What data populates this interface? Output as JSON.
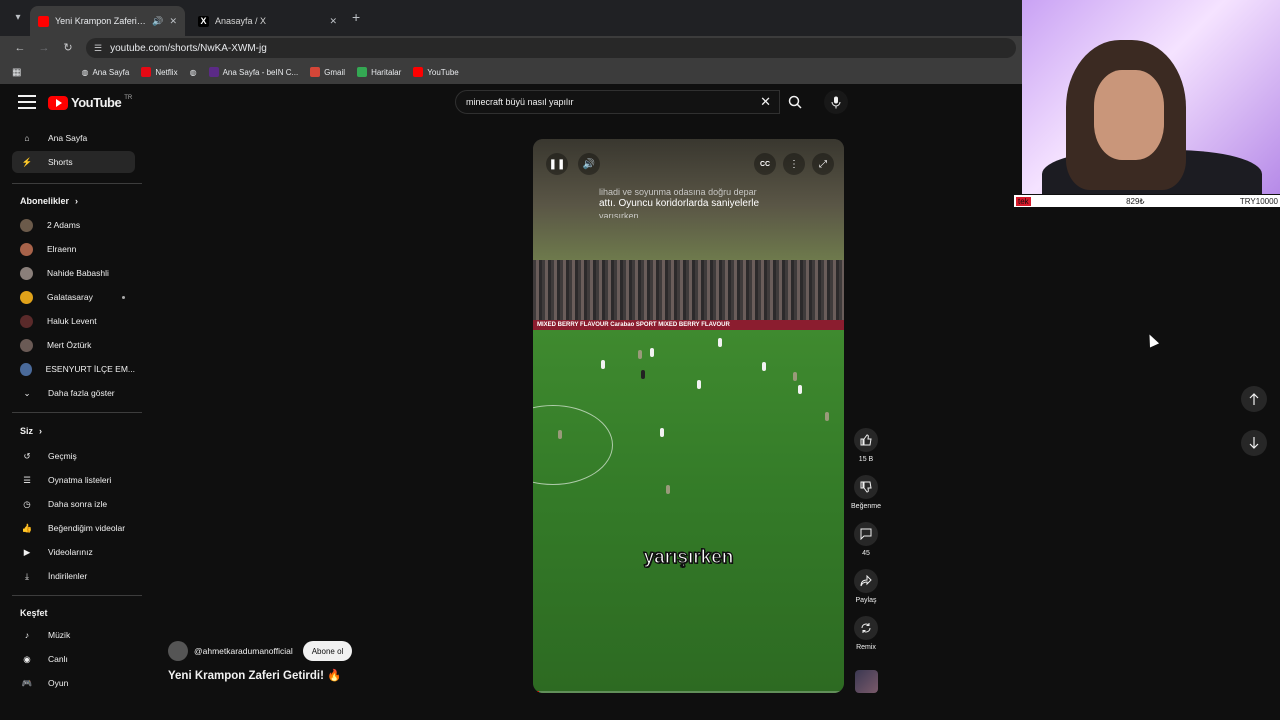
{
  "browser": {
    "tabs": [
      {
        "title": "Yeni Krampon Zaferi Getirdi",
        "icon": "youtube-icon",
        "active": true
      },
      {
        "title": "Anasayfa / X",
        "icon": "x-icon",
        "active": false
      }
    ],
    "url": "youtube.com/shorts/NwKA-XWM-jg",
    "bookmarks": [
      "Ana Sayfa",
      "Netflix",
      "Ana Sayfa - beIN C...",
      "Gmail",
      "Haritalar",
      "YouTube"
    ]
  },
  "ticker": {
    "left": "tek",
    "mid": "829₺",
    "right": "TRY10000"
  },
  "masthead": {
    "logo_text": "YouTube",
    "region": "TR",
    "search_value": "minecraft büyü nasıl yapılır"
  },
  "sidebar": {
    "main": [
      {
        "label": "Ana Sayfa",
        "icon": "home-icon"
      },
      {
        "label": "Shorts",
        "icon": "shorts-icon",
        "selected": true
      }
    ],
    "subscriptions_heading": "Abonelikler",
    "subscriptions": [
      "2 Adams",
      "Elraenn",
      "Nahide Babashli",
      "Galatasaray",
      "Haluk Levent",
      "Mert Öztürk",
      "ESENYURT İLÇE EM..."
    ],
    "show_more": "Daha fazla göster",
    "you_heading": "Siz",
    "you": [
      {
        "label": "Geçmiş",
        "icon": "history-icon"
      },
      {
        "label": "Oynatma listeleri",
        "icon": "playlist-icon"
      },
      {
        "label": "Daha sonra izle",
        "icon": "clock-icon"
      },
      {
        "label": "Beğendiğim videolar",
        "icon": "like-icon"
      },
      {
        "label": "Videolarınız",
        "icon": "video-icon"
      },
      {
        "label": "İndirilenler",
        "icon": "download-icon"
      }
    ],
    "explore_heading": "Keşfet",
    "explore": [
      {
        "label": "Müzik",
        "icon": "music-icon"
      },
      {
        "label": "Canlı",
        "icon": "live-icon"
      },
      {
        "label": "Oyun",
        "icon": "gaming-icon"
      }
    ]
  },
  "short": {
    "caption_line1": "lihadi ve soyunma odasına doğru depar",
    "caption_line2": "attı. Oyuncu koridorlarda saniyelerle",
    "caption_line3": "yarışırken",
    "board_text": "MIXED BERRY FLAVOUR      Carabao      SPORT      MIXED BERRY FLAVOUR",
    "subtitle": "yarışırken",
    "progress": 0.02,
    "channel": "@ahmetkaradumanofficial",
    "subscribe": "Abone ol",
    "title": "Yeni Krampon Zaferi Getirdi! 🔥"
  },
  "actions": {
    "like_count": "15 B",
    "dislike_label": "Beğenme",
    "comment_count": "45",
    "share_label": "Paylaş",
    "remix_label": "Remix"
  }
}
